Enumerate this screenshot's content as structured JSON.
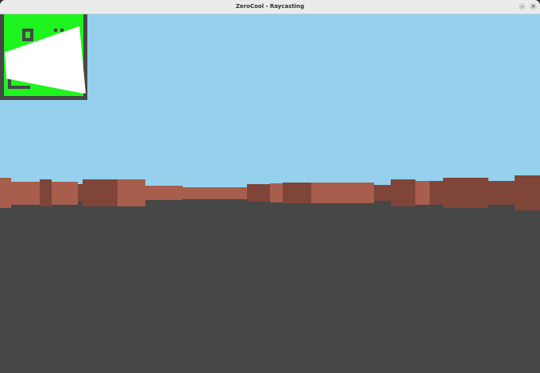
{
  "window": {
    "title": "ZeroCool - Raycasting",
    "minimize_glyph": "–",
    "close_glyph": "×"
  },
  "colors": {
    "sky": "#95d1ec",
    "floor": "#474747",
    "wall_light": "#a85e4d",
    "wall_dark": "#7e4538",
    "minimap_floor": "#1ef41e",
    "minimap_wall": "#474747",
    "minimap_rays": "#ffffff"
  },
  "icons": {
    "minimize": "minimize-icon",
    "close": "close-icon"
  }
}
